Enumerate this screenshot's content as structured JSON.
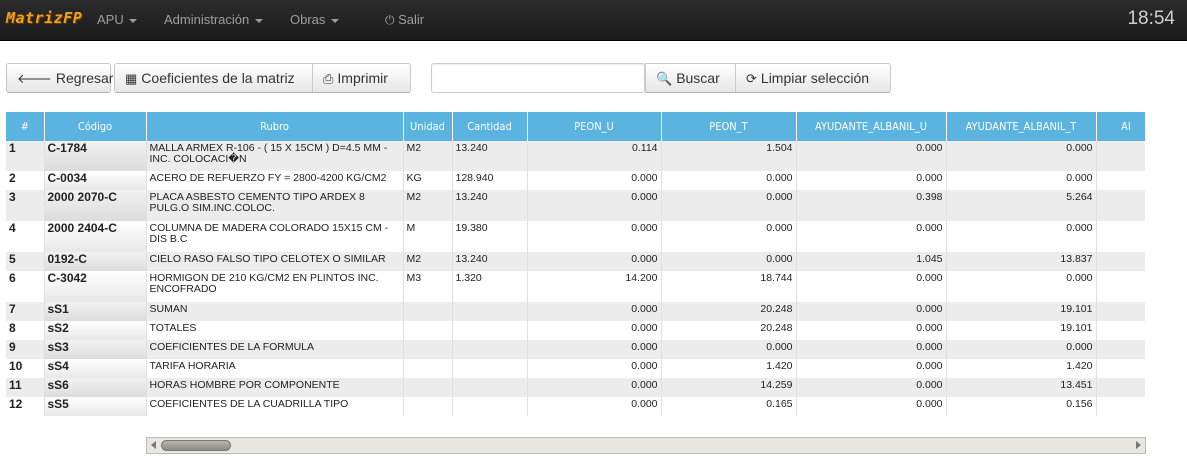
{
  "navbar": {
    "brand": "MatrizFP",
    "menu": [
      {
        "label": "APU",
        "has_caret": true
      },
      {
        "label": "Administración",
        "has_caret": true
      },
      {
        "label": "Obras",
        "has_caret": true
      },
      {
        "label": "Salir",
        "icon": "power-icon"
      }
    ],
    "clock": "18:54"
  },
  "toolbar": {
    "back_label": "Regresar",
    "coefficients_label": "Coeficientes de la matriz",
    "print_label": "Imprimir",
    "search_value": "",
    "search_label": "Buscar",
    "clear_label": "Limpiar selección"
  },
  "table": {
    "headers": [
      "#",
      "Código",
      "Rubro",
      "Unidad",
      "Cantidad",
      "PEON_U",
      "PEON_T",
      "AYUDANTE_ALBANIL_U",
      "AYUDANTE_ALBANIL_T",
      "AI"
    ],
    "rows": [
      {
        "n": "1",
        "code": "C-1784",
        "rubro": "MALLA ARMEX R-106 - ( 15 X 15CM ) D=4.5 MM - INC. COLOCACI�N",
        "unidad": "M2",
        "cantidad": "13.240",
        "peon_u": "0.114",
        "peon_t": "1.504",
        "ayu_u": "0.000",
        "ayu_t": "0.000"
      },
      {
        "n": "2",
        "code": "C-0034",
        "rubro": "ACERO DE REFUERZO FY = 2800-4200 KG/CM2",
        "unidad": "KG",
        "cantidad": "128.940",
        "peon_u": "0.000",
        "peon_t": "0.000",
        "ayu_u": "0.000",
        "ayu_t": "0.000"
      },
      {
        "n": "3",
        "code": "2000 2070-C",
        "rubro": "PLACA ASBESTO CEMENTO TIPO ARDEX 8 PULG.O SIM.INC.COLOC.",
        "unidad": "M2",
        "cantidad": "13.240",
        "peon_u": "0.000",
        "peon_t": "0.000",
        "ayu_u": "0.398",
        "ayu_t": "5.264"
      },
      {
        "n": "4",
        "code": "2000 2404-C",
        "rubro": "COLUMNA DE MADERA COLORADO 15X15 CM - DIS B.C",
        "unidad": "M",
        "cantidad": "19.380",
        "peon_u": "0.000",
        "peon_t": "0.000",
        "ayu_u": "0.000",
        "ayu_t": "0.000"
      },
      {
        "n": "5",
        "code": "0192-C",
        "rubro": "CIELO RASO FALSO TIPO CELOTEX O SIMILAR",
        "unidad": "M2",
        "cantidad": "13.240",
        "peon_u": "0.000",
        "peon_t": "0.000",
        "ayu_u": "1.045",
        "ayu_t": "13.837"
      },
      {
        "n": "6",
        "code": "C-3042",
        "rubro": "HORMIGON DE 210 KG/CM2 EN PLINTOS INC. ENCOFRADO",
        "unidad": "M3",
        "cantidad": "1.320",
        "peon_u": "14.200",
        "peon_t": "18.744",
        "ayu_u": "0.000",
        "ayu_t": "0.000"
      },
      {
        "n": "7",
        "code": "sS1",
        "rubro": "SUMAN",
        "unidad": "",
        "cantidad": "",
        "peon_u": "0.000",
        "peon_t": "20.248",
        "ayu_u": "0.000",
        "ayu_t": "19.101"
      },
      {
        "n": "8",
        "code": "sS2",
        "rubro": "TOTALES",
        "unidad": "",
        "cantidad": "",
        "peon_u": "0.000",
        "peon_t": "20.248",
        "ayu_u": "0.000",
        "ayu_t": "19.101"
      },
      {
        "n": "9",
        "code": "sS3",
        "rubro": "COEFICIENTES DE LA FORMULA",
        "unidad": "",
        "cantidad": "",
        "peon_u": "0.000",
        "peon_t": "0.000",
        "ayu_u": "0.000",
        "ayu_t": "0.000"
      },
      {
        "n": "10",
        "code": "sS4",
        "rubro": "TARIFA HORARIA",
        "unidad": "",
        "cantidad": "",
        "peon_u": "0.000",
        "peon_t": "1.420",
        "ayu_u": "0.000",
        "ayu_t": "1.420"
      },
      {
        "n": "11",
        "code": "sS6",
        "rubro": "HORAS HOMBRE POR COMPONENTE",
        "unidad": "",
        "cantidad": "",
        "peon_u": "0.000",
        "peon_t": "14.259",
        "ayu_u": "0.000",
        "ayu_t": "13.451"
      },
      {
        "n": "12",
        "code": "sS5",
        "rubro": "COEFICIENTES DE LA CUADRILLA TIPO",
        "unidad": "",
        "cantidad": "",
        "peon_u": "0.000",
        "peon_t": "0.165",
        "ayu_u": "0.000",
        "ayu_t": "0.156"
      }
    ]
  }
}
